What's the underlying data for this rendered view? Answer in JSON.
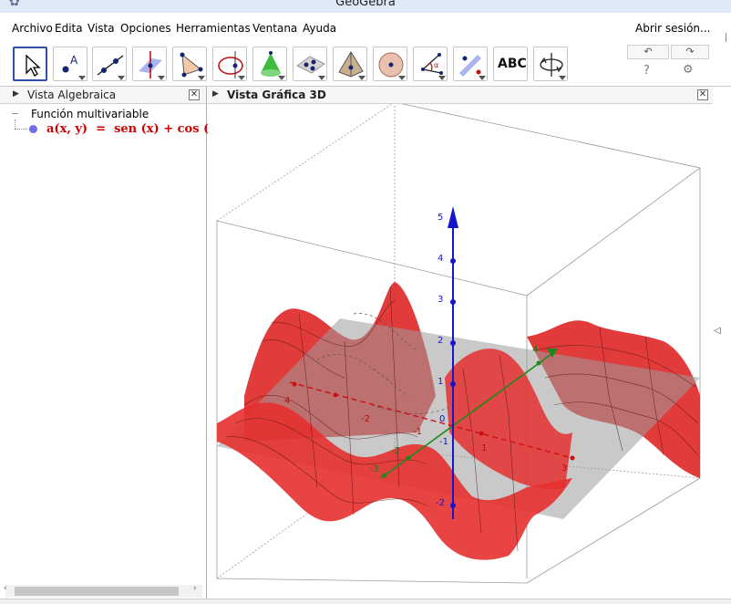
{
  "window": {
    "title": "GeoGebra",
    "login": "Abrir sesión..."
  },
  "menu": [
    "Archivo",
    "Edita",
    "Vista",
    "Opciones",
    "Herramientas",
    "Ventana",
    "Ayuda"
  ],
  "toolbar": {
    "tools": [
      "move-tool",
      "point-tool",
      "line-tool",
      "perpendicular-line-tool",
      "polygon-tool",
      "circle-axis-tool",
      "cone-tool",
      "plane-tool",
      "pyramid-tool",
      "sphere-tool",
      "angle-tool",
      "reflect-tool",
      "text-tool",
      "rotate-view-tool"
    ],
    "text_tool_label": "ABC",
    "undo_icon": "undo-icon",
    "redo_icon": "redo-icon",
    "help": "?",
    "settings": "⚙"
  },
  "algebra_view": {
    "title": "Vista Algebraica",
    "group": "Función multivariable",
    "function": "a(x, y)  =  sen (x) + cos (y)",
    "function_color": "#cc0000"
  },
  "graphics_view": {
    "title": "Vista Gráfica 3D",
    "z_ticks": [
      "5",
      "4",
      "3",
      "2",
      "1",
      "0",
      "-1",
      "-2"
    ],
    "x_ticks": [
      "4",
      "-2",
      "-1",
      "1",
      "3"
    ],
    "y_ticks": [
      "4",
      "-2",
      "-3"
    ],
    "colors": {
      "surface": "#e52b2b",
      "plane": "#a0a0a0",
      "z_axis": "#1515cc",
      "y_axis": "#1a8a1a",
      "x_axis": "#cc1010"
    }
  }
}
